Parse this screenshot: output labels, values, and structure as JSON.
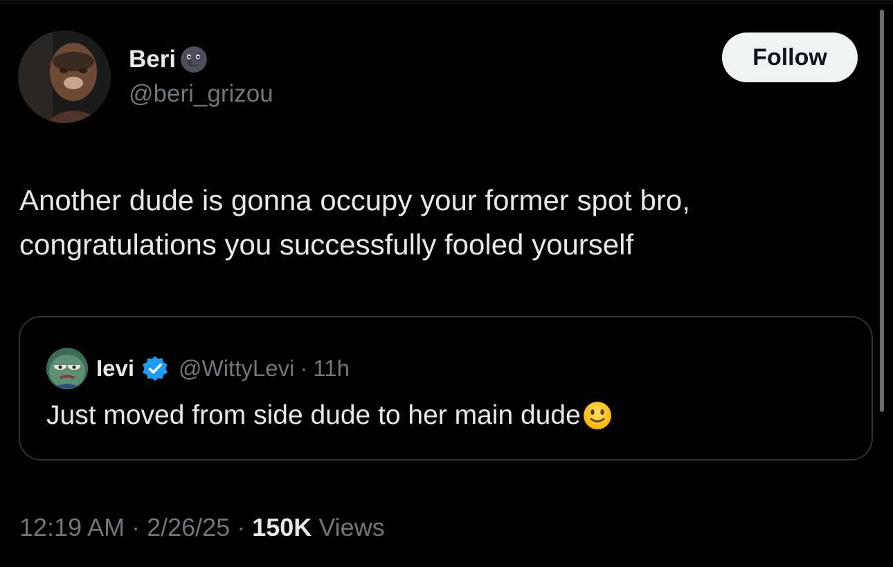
{
  "author": {
    "name": "Beri",
    "handle": "@beri_grizou",
    "emoji_icon": "new-moon-face-icon"
  },
  "follow_label": "Follow",
  "tweet_text": "Another dude is gonna occupy your former spot bro,\ncongratulations you successfully fooled yourself",
  "quoted": {
    "name": "Ɩevi",
    "verified": true,
    "handle": "@WittyLevi",
    "dot": "·",
    "time": "11h",
    "text": "Just moved from side dude to her main dude",
    "emoji_icon": "slightly-smiling-face-icon"
  },
  "meta": {
    "time": "12:19 AM",
    "sep1": "·",
    "date": "2/26/25",
    "sep2": "·",
    "views_count": "150K",
    "views_label": "Views"
  },
  "colors": {
    "background": "#000000",
    "text": "#e7e9ea",
    "secondary": "#71767b",
    "verified": "#1d9bf0",
    "border": "#2f3336"
  }
}
